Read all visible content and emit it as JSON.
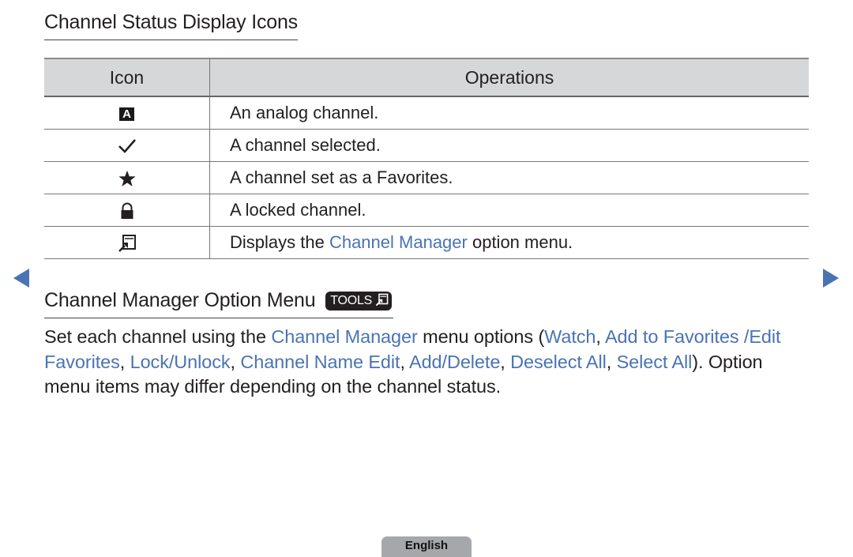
{
  "section1": {
    "title": "Channel Status Display Icons",
    "table": {
      "headers": [
        "Icon",
        "Operations"
      ],
      "rows": [
        {
          "icon": "analog-a-icon",
          "glyph": "A",
          "text_parts": [
            {
              "t": "An analog channel.",
              "link": false
            }
          ]
        },
        {
          "icon": "checkmark-icon",
          "text_parts": [
            {
              "t": "A channel selected.",
              "link": false
            }
          ]
        },
        {
          "icon": "star-icon",
          "text_parts": [
            {
              "t": "A channel set as a Favorites.",
              "link": false
            }
          ]
        },
        {
          "icon": "lock-icon",
          "text_parts": [
            {
              "t": "A locked channel.",
              "link": false
            }
          ]
        },
        {
          "icon": "tools-menu-icon",
          "text_parts": [
            {
              "t": "Displays the ",
              "link": false
            },
            {
              "t": "Channel Manager",
              "link": true
            },
            {
              "t": " option menu.",
              "link": false
            }
          ]
        }
      ]
    }
  },
  "section2": {
    "title": "Channel Manager Option Menu",
    "badge_label": "TOOLS",
    "paragraph": [
      {
        "t": "Set each channel using the ",
        "link": false
      },
      {
        "t": "Channel Manager",
        "link": true
      },
      {
        "t": " menu options (",
        "link": false
      },
      {
        "t": "Watch",
        "link": true
      },
      {
        "t": ", ",
        "link": false
      },
      {
        "t": "Add to Favorites /Edit Favorites",
        "link": true
      },
      {
        "t": ", ",
        "link": false
      },
      {
        "t": "Lock/Unlock",
        "link": true
      },
      {
        "t": ", ",
        "link": false
      },
      {
        "t": "Channel Name Edit",
        "link": true
      },
      {
        "t": ", ",
        "link": false
      },
      {
        "t": "Add/Delete",
        "link": true
      },
      {
        "t": ", ",
        "link": false
      },
      {
        "t": "Deselect All",
        "link": true
      },
      {
        "t": ", ",
        "link": false
      },
      {
        "t": "Select All",
        "link": true
      },
      {
        "t": "). Option menu items may differ depending on the channel status.",
        "link": false
      }
    ]
  },
  "nav": {
    "prev": "previous-page",
    "next": "next-page"
  },
  "footer": {
    "language_label": "English"
  },
  "colors": {
    "link": "#4a73b3",
    "text": "#231f20",
    "header_bg": "#d6d7d9",
    "language_tab": "#a6a7aa"
  }
}
